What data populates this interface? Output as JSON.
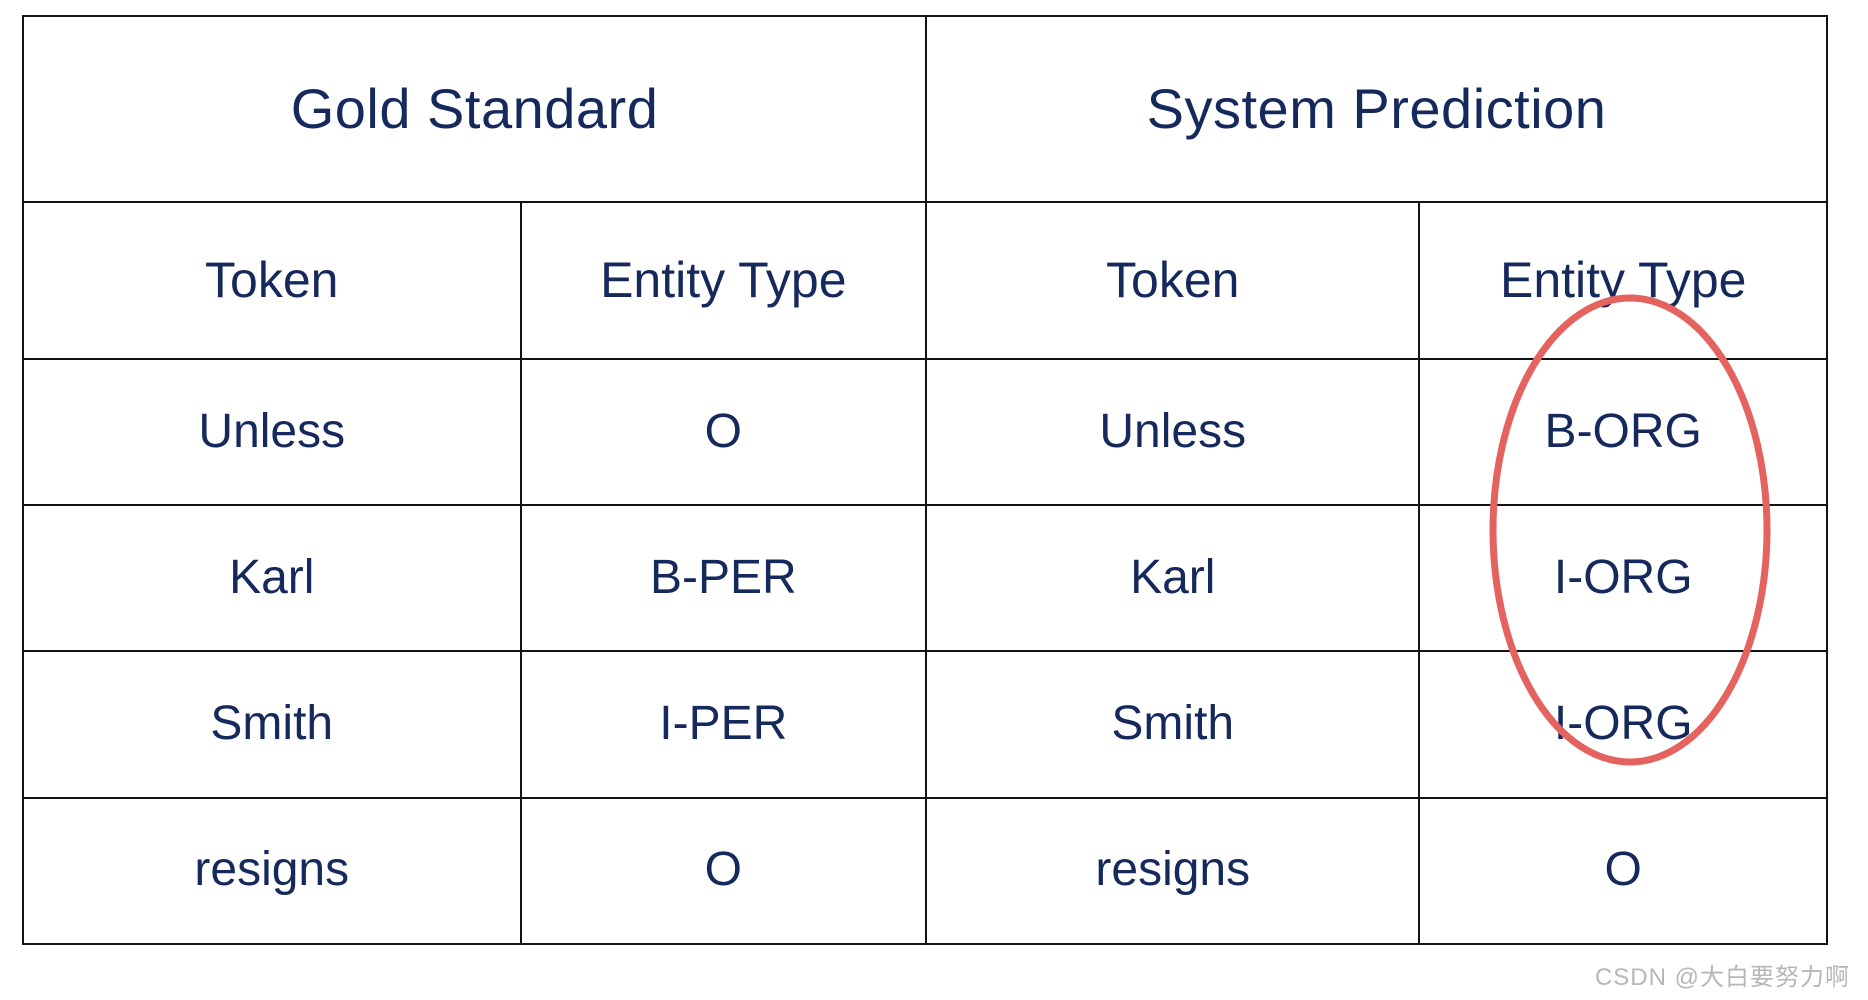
{
  "figure": {
    "kind": "comparison-table",
    "text_color": "#16295c",
    "border_color": "#121212",
    "background_color": "#ffffff",
    "annotation_color": "#e4635f"
  },
  "table": {
    "group_headers": [
      {
        "label": "Gold Standard",
        "span": 2
      },
      {
        "label": "System Prediction",
        "span": 2
      }
    ],
    "column_headers": [
      "Token",
      "Entity Type",
      "Token",
      "Entity Type"
    ],
    "rows": [
      {
        "gold_token": "Unless",
        "gold_type": "O",
        "pred_token": "Unless",
        "pred_type": "B-ORG"
      },
      {
        "gold_token": "Karl",
        "gold_type": "B-PER",
        "pred_token": "Karl",
        "pred_type": "I-ORG"
      },
      {
        "gold_token": "Smith",
        "gold_type": "I-PER",
        "pred_token": "Smith",
        "pred_type": "I-ORG"
      },
      {
        "gold_token": "resigns",
        "gold_type": "O",
        "pred_token": "resigns",
        "pred_type": "O"
      }
    ]
  },
  "annotation": {
    "shape": "ellipse",
    "color": "#e4635f",
    "stroke_width": 7,
    "targets": [
      "B-ORG",
      "I-ORG",
      "I-ORG"
    ],
    "description": "Red ellipse highlighting the predicted entity-type cells B-ORG / I-ORG / I-ORG"
  },
  "watermark": {
    "text": "CSDN @大白要努力啊"
  }
}
